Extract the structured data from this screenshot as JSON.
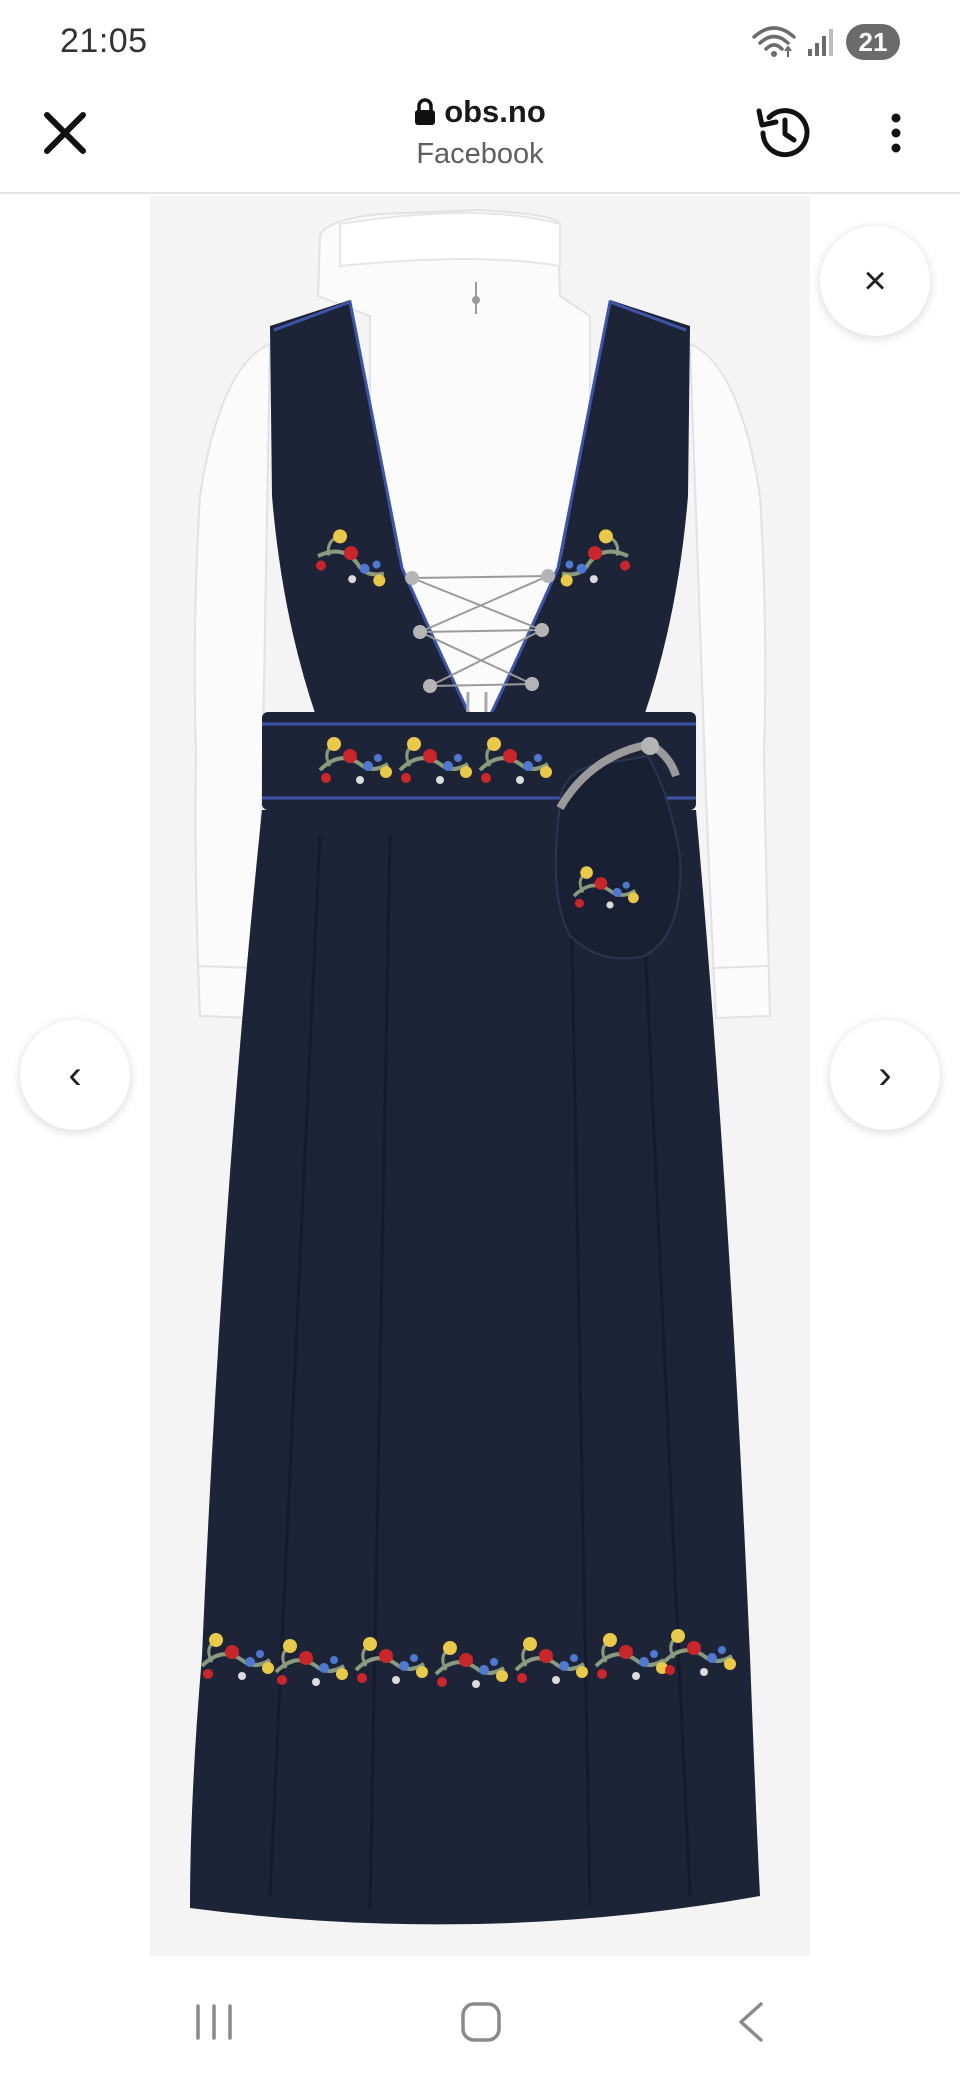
{
  "status_bar": {
    "time": "21:05",
    "battery_level": "21",
    "icons": [
      "wifi-icon",
      "signal-icon"
    ]
  },
  "toolbar": {
    "url": "obs.no",
    "subtitle": "Facebook",
    "icons": [
      "close-icon",
      "lock-icon",
      "history-icon",
      "more-vert-icon"
    ]
  },
  "viewer": {
    "close_glyph": "×",
    "prev_glyph": "‹",
    "next_glyph": "›",
    "image_subject": "bunad-dress"
  },
  "nav_bar": {
    "icons": [
      "recents-icon",
      "home-icon",
      "back-icon"
    ]
  },
  "colors": {
    "dress_navy": "#1e2438",
    "shirt_white": "#fbfbfb",
    "photo_background": "#f4f4f4",
    "embroidery_red": "#c8262b",
    "embroidery_yellow": "#e8c94a",
    "embroidery_blue": "#4f78d0",
    "embroidery_green": "#8a9a7e",
    "silver": "#9a9a9a"
  }
}
